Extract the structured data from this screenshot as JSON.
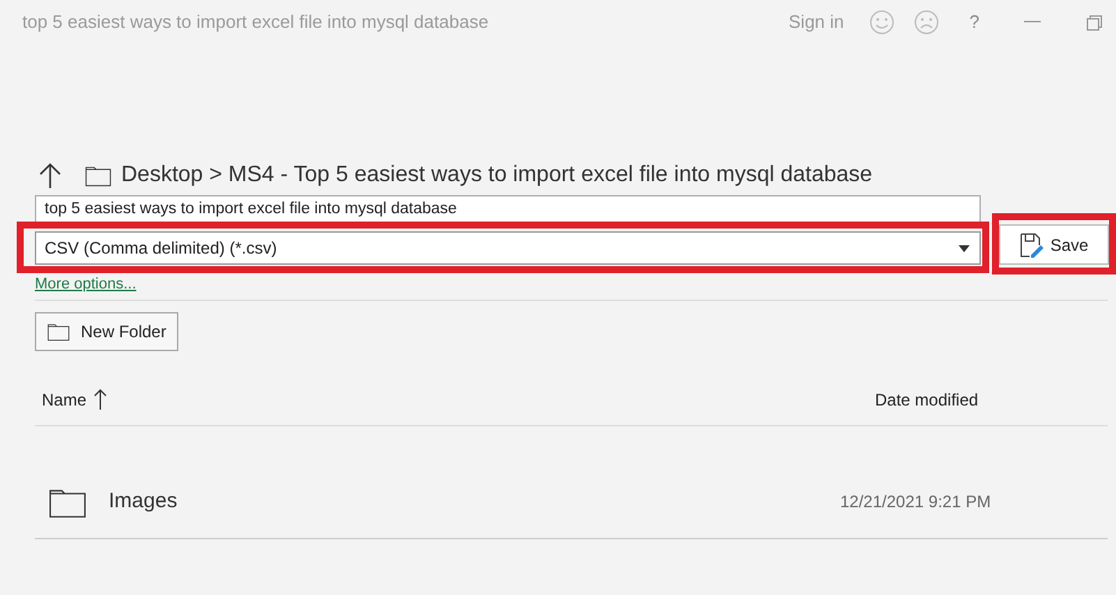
{
  "window": {
    "title": "top 5 easiest ways to import excel file into mysql database",
    "sign_in": "Sign in",
    "help": "?"
  },
  "path": {
    "segments": [
      "Desktop",
      "MS4 - Top 5 easiest ways to import excel file into mysql database"
    ],
    "separator": ">"
  },
  "file_name": {
    "value": "top 5 easiest ways to import excel file into mysql database"
  },
  "file_type": {
    "value": "CSV (Comma delimited) (*.csv)",
    "highlighted": true
  },
  "save_button": {
    "label": "Save",
    "highlighted": true
  },
  "more_options": "More options...",
  "new_folder": "New Folder",
  "table": {
    "columns": [
      {
        "label": "Name",
        "sorted": true
      },
      {
        "label": "Date modified",
        "sorted": false
      }
    ],
    "rows": [
      {
        "name": "Images",
        "date": "12/21/2021 9:21 PM"
      }
    ]
  }
}
